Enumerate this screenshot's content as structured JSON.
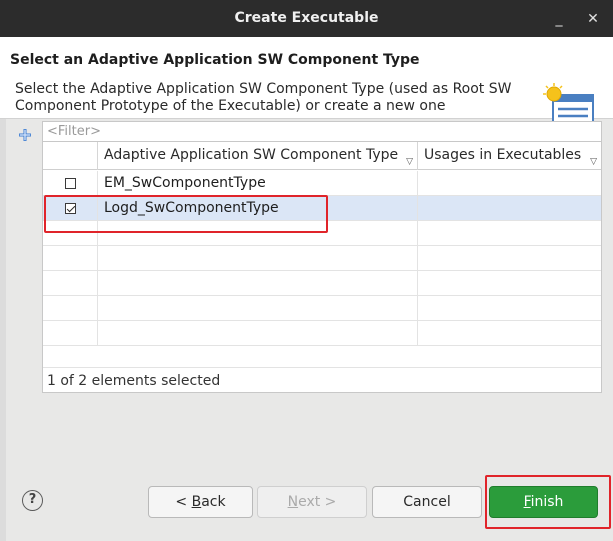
{
  "window": {
    "title": "Create Executable",
    "minimize_glyph": "_",
    "close_glyph": "✕"
  },
  "header": {
    "title": "Select an Adaptive Application SW Component Type",
    "description_line1": "Select the Adaptive Application SW Component Type (used as Root SW",
    "description_line2": "Component Prototype of the Executable) or create a new one",
    "icon": "wizard-banner-icon"
  },
  "filter": {
    "placeholder": "<Filter>"
  },
  "table": {
    "columns": [
      "",
      "Adaptive Application SW Component Type",
      "Usages in Executables"
    ],
    "rows": [
      {
        "checked": false,
        "name": "EM_SwComponentType",
        "usages": ""
      },
      {
        "checked": true,
        "name": "Logd_SwComponentType",
        "usages": ""
      }
    ],
    "status": "1 of 2 elements selected"
  },
  "footer": {
    "help_glyph": "?",
    "back_prefix": "< ",
    "back_mnemonic": "B",
    "back_rest": "ack",
    "next_mnemonic": "N",
    "next_rest": "ext >",
    "cancel_label": "Cancel",
    "finish_mnemonic": "F",
    "finish_rest": "inish"
  },
  "colors": {
    "accent_green": "#2b9c3b",
    "highlight_red": "#e0242a",
    "selection_blue": "#dbe6f6"
  }
}
